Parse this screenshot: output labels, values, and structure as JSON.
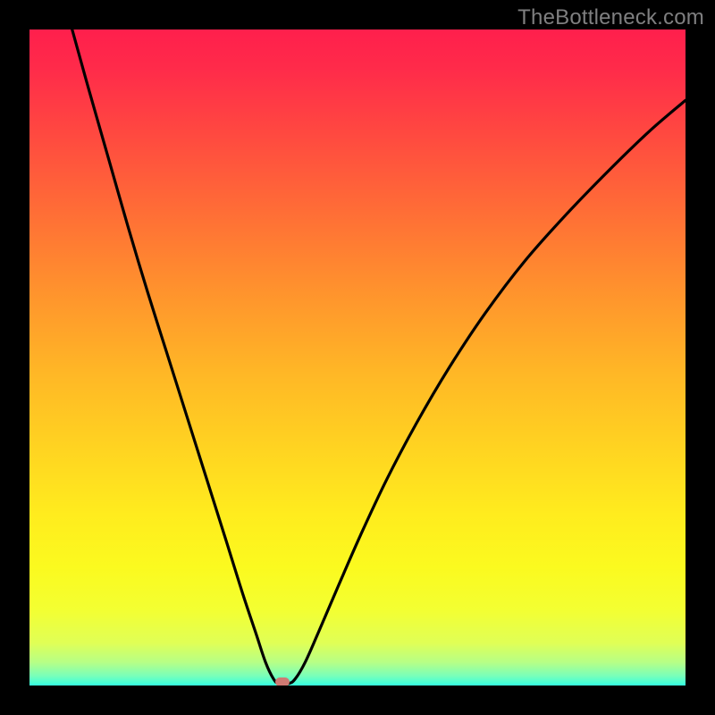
{
  "watermark": "TheBottleneck.com",
  "marker": {
    "color": "#cf7a73",
    "x_frac": 0.385,
    "y_frac": 0.995
  },
  "gradient_stops": [
    {
      "pos": 0.0,
      "color": "#ff1f4c"
    },
    {
      "pos": 0.06,
      "color": "#ff2b4a"
    },
    {
      "pos": 0.16,
      "color": "#ff4940"
    },
    {
      "pos": 0.28,
      "color": "#ff6e36"
    },
    {
      "pos": 0.4,
      "color": "#ff932d"
    },
    {
      "pos": 0.52,
      "color": "#ffb626"
    },
    {
      "pos": 0.64,
      "color": "#ffd421"
    },
    {
      "pos": 0.74,
      "color": "#ffec1e"
    },
    {
      "pos": 0.82,
      "color": "#fbfa1f"
    },
    {
      "pos": 0.885,
      "color": "#f3ff32"
    },
    {
      "pos": 0.935,
      "color": "#e0ff56"
    },
    {
      "pos": 0.965,
      "color": "#b6ff87"
    },
    {
      "pos": 0.985,
      "color": "#7affb9"
    },
    {
      "pos": 1.0,
      "color": "#35ffe0"
    }
  ],
  "chart_data": {
    "type": "line",
    "title": "",
    "xlabel": "",
    "ylabel": "",
    "xlim": [
      0,
      1
    ],
    "ylim": [
      0,
      1
    ],
    "note": "Pixel-read (x_frac, y_frac) of the black curve inside the plot area. (0,0)=top-left, (1,1)=bottom-right. The curve dips to y≈1 (bottom/green = no bottleneck) near x≈0.385 and rises toward y≈0 (top/red = high bottleneck) at the edges.",
    "series": [
      {
        "name": "bottleneck-curve",
        "points": [
          [
            0.065,
            0.0
          ],
          [
            0.09,
            0.09
          ],
          [
            0.12,
            0.195
          ],
          [
            0.15,
            0.3
          ],
          [
            0.18,
            0.4
          ],
          [
            0.21,
            0.495
          ],
          [
            0.24,
            0.59
          ],
          [
            0.27,
            0.685
          ],
          [
            0.3,
            0.78
          ],
          [
            0.325,
            0.86
          ],
          [
            0.345,
            0.92
          ],
          [
            0.36,
            0.965
          ],
          [
            0.372,
            0.99
          ],
          [
            0.38,
            0.997
          ],
          [
            0.395,
            0.997
          ],
          [
            0.405,
            0.99
          ],
          [
            0.42,
            0.965
          ],
          [
            0.44,
            0.92
          ],
          [
            0.47,
            0.85
          ],
          [
            0.505,
            0.77
          ],
          [
            0.545,
            0.685
          ],
          [
            0.59,
            0.6
          ],
          [
            0.64,
            0.515
          ],
          [
            0.695,
            0.432
          ],
          [
            0.755,
            0.353
          ],
          [
            0.82,
            0.28
          ],
          [
            0.885,
            0.213
          ],
          [
            0.945,
            0.155
          ],
          [
            1.0,
            0.108
          ]
        ]
      }
    ],
    "marker_point": {
      "x": 0.385,
      "y": 0.995,
      "shape": "rounded-rect",
      "color": "#cf7a73"
    }
  }
}
